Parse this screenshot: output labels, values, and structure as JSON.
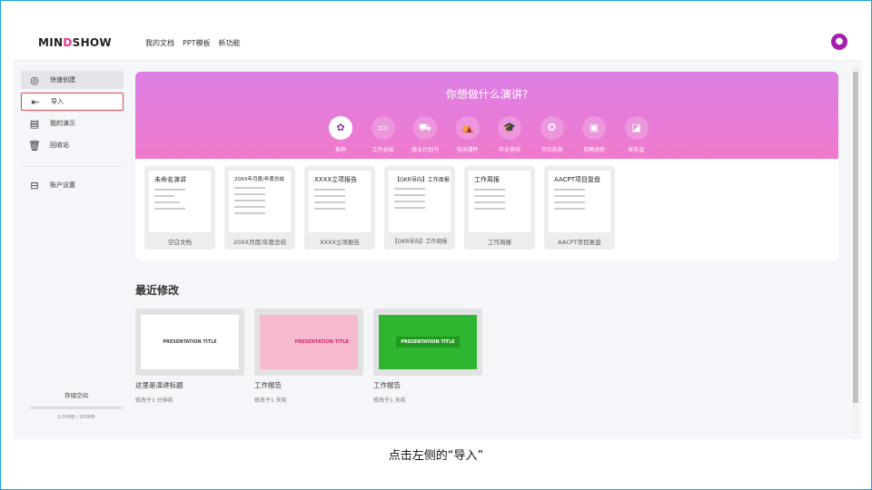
{
  "header": {
    "logo_pre": "MIN",
    "logo_d": "D",
    "logo_post": "SHOW",
    "nav": [
      "我的文档",
      "PPT模板",
      "新功能"
    ],
    "avatar_icon": "user-icon"
  },
  "sidebar": {
    "items": [
      {
        "label": "快速创建",
        "icon": "brain-icon"
      },
      {
        "label": "导入",
        "icon": "import-icon"
      },
      {
        "label": "我的演示",
        "icon": "presentation-icon"
      },
      {
        "label": "回收站",
        "icon": "trash-icon"
      },
      {
        "label": "账户设置",
        "icon": "account-icon"
      }
    ],
    "storage_label": "存储空间",
    "storage_value": "0.00MB / 100MB",
    "storage_fraction": 0
  },
  "hero": {
    "title": "你想做什么演讲?",
    "categories": [
      "推荐",
      "工作总结",
      "商业计划书",
      "培训课件",
      "毕业答辩",
      "节日庆典",
      "竞聘述职",
      "发布会"
    ]
  },
  "templates": [
    {
      "title": "未命名演讲",
      "label": "空白文档"
    },
    {
      "title": "20XX年月度/年度总结",
      "label": "20XX月度/年度总结"
    },
    {
      "title": "XXXX立项报告",
      "label": "XXXX立项报告"
    },
    {
      "title": "【OKR导向】工作周报",
      "label": "【OKR导向】工作周报"
    },
    {
      "title": "工作周报",
      "label": "工作周报"
    },
    {
      "title": "AACPT项目复盘",
      "label": "AACPT项目复盘"
    }
  ],
  "recent": {
    "title": "最近修改",
    "items": [
      {
        "thumb": "PRESENTATION TITLE",
        "name": "这里是演讲标题",
        "time": "修改于1 分钟前"
      },
      {
        "thumb": "PRESENTATION TITLE",
        "name": "工作报告",
        "time": "修改于1 天前"
      },
      {
        "thumb": "PRESENTATION TITLE",
        "name": "工作报告",
        "time": "修改于1 天前"
      }
    ]
  },
  "caption": "点击左侧的“导入”"
}
